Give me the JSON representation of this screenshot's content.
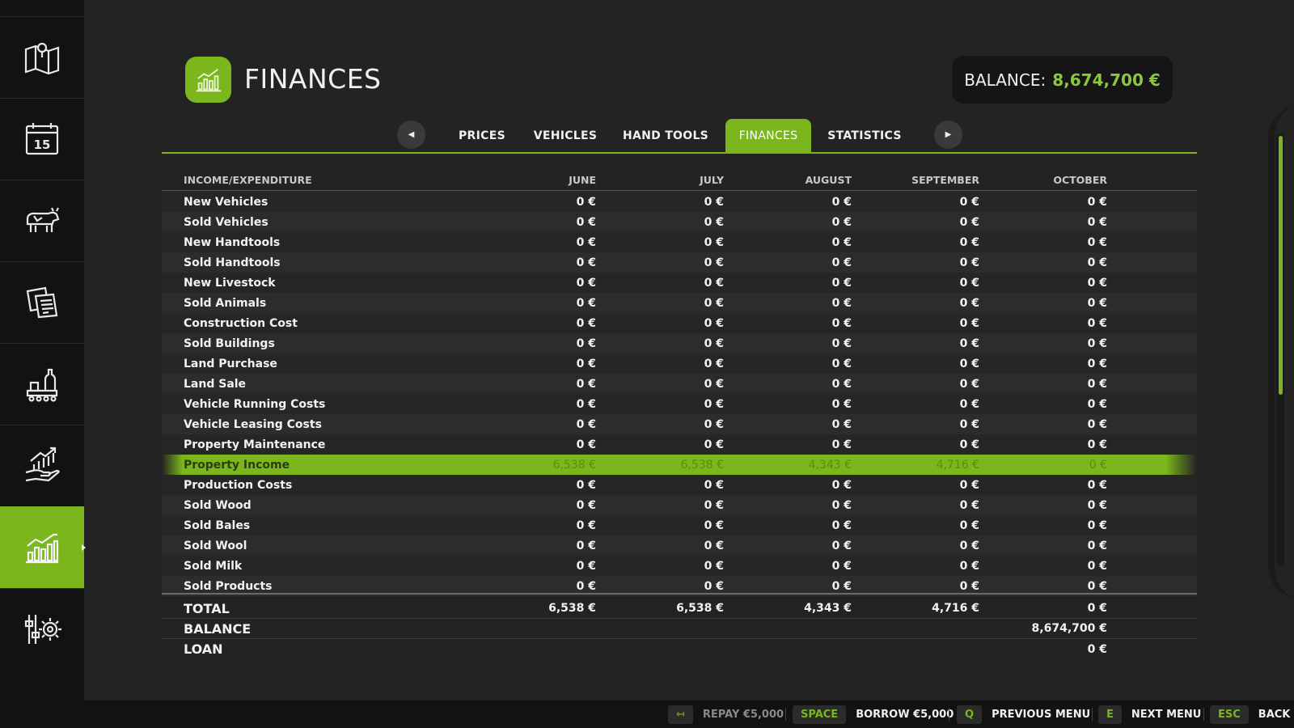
{
  "sidebar": {
    "items": [
      {
        "icon": "map-icon"
      },
      {
        "icon": "calendar-icon",
        "day": "15"
      },
      {
        "icon": "animals-icon"
      },
      {
        "icon": "contracts-icon"
      },
      {
        "icon": "production-icon"
      },
      {
        "icon": "prices-icon"
      },
      {
        "icon": "finances-icon",
        "active": true
      },
      {
        "icon": "settings-icon"
      }
    ]
  },
  "header": {
    "title": "FINANCES",
    "balance_label": "BALANCE:",
    "balance_value": "8,674,700 €"
  },
  "tabs": [
    {
      "label": "PRICES"
    },
    {
      "label": "VEHICLES"
    },
    {
      "label": "HAND TOOLS"
    },
    {
      "label": "FINANCES",
      "active": true
    },
    {
      "label": "STATISTICS"
    }
  ],
  "table": {
    "headers": [
      "INCOME/EXPENDITURE",
      "JUNE",
      "JULY",
      "AUGUST",
      "SEPTEMBER",
      "OCTOBER"
    ],
    "rows": [
      {
        "label": "New Vehicles",
        "values": [
          "0 €",
          "0 €",
          "0 €",
          "0 €",
          "0 €"
        ]
      },
      {
        "label": "Sold Vehicles",
        "values": [
          "0 €",
          "0 €",
          "0 €",
          "0 €",
          "0 €"
        ]
      },
      {
        "label": "New Handtools",
        "values": [
          "0 €",
          "0 €",
          "0 €",
          "0 €",
          "0 €"
        ]
      },
      {
        "label": "Sold Handtools",
        "values": [
          "0 €",
          "0 €",
          "0 €",
          "0 €",
          "0 €"
        ]
      },
      {
        "label": "New Livestock",
        "values": [
          "0 €",
          "0 €",
          "0 €",
          "0 €",
          "0 €"
        ]
      },
      {
        "label": "Sold Animals",
        "values": [
          "0 €",
          "0 €",
          "0 €",
          "0 €",
          "0 €"
        ]
      },
      {
        "label": "Construction Cost",
        "values": [
          "0 €",
          "0 €",
          "0 €",
          "0 €",
          "0 €"
        ]
      },
      {
        "label": "Sold Buildings",
        "values": [
          "0 €",
          "0 €",
          "0 €",
          "0 €",
          "0 €"
        ]
      },
      {
        "label": "Land Purchase",
        "values": [
          "0 €",
          "0 €",
          "0 €",
          "0 €",
          "0 €"
        ]
      },
      {
        "label": "Land Sale",
        "values": [
          "0 €",
          "0 €",
          "0 €",
          "0 €",
          "0 €"
        ]
      },
      {
        "label": "Vehicle Running Costs",
        "values": [
          "0 €",
          "0 €",
          "0 €",
          "0 €",
          "0 €"
        ]
      },
      {
        "label": "Vehicle Leasing Costs",
        "values": [
          "0 €",
          "0 €",
          "0 €",
          "0 €",
          "0 €"
        ]
      },
      {
        "label": "Property Maintenance",
        "values": [
          "0 €",
          "0 €",
          "0 €",
          "0 €",
          "0 €"
        ]
      },
      {
        "label": "Property Income",
        "values": [
          "6,538 €",
          "6,538 €",
          "4,343 €",
          "4,716 €",
          "0 €"
        ],
        "highlighted": true
      },
      {
        "label": "Production Costs",
        "values": [
          "0 €",
          "0 €",
          "0 €",
          "0 €",
          "0 €"
        ]
      },
      {
        "label": "Sold Wood",
        "values": [
          "0 €",
          "0 €",
          "0 €",
          "0 €",
          "0 €"
        ]
      },
      {
        "label": "Sold Bales",
        "values": [
          "0 €",
          "0 €",
          "0 €",
          "0 €",
          "0 €"
        ]
      },
      {
        "label": "Sold Wool",
        "values": [
          "0 €",
          "0 €",
          "0 €",
          "0 €",
          "0 €"
        ]
      },
      {
        "label": "Sold Milk",
        "values": [
          "0 €",
          "0 €",
          "0 €",
          "0 €",
          "0 €"
        ]
      },
      {
        "label": "Sold Products",
        "values": [
          "0 €",
          "0 €",
          "0 €",
          "0 €",
          "0 €"
        ]
      }
    ],
    "total": {
      "label": "TOTAL",
      "values": [
        "6,538 €",
        "6,538 €",
        "4,343 €",
        "4,716 €",
        "0 €"
      ]
    },
    "balance": {
      "label": "BALANCE",
      "value": "8,674,700 €"
    },
    "loan": {
      "label": "LOAN",
      "value": "0 €"
    }
  },
  "footer": {
    "repay": {
      "key": "↤",
      "label": "REPAY €5,000"
    },
    "borrow": {
      "key": "SPACE",
      "label": "BORROW €5,000"
    },
    "previous": {
      "key": "Q",
      "label": "PREVIOUS MENU"
    },
    "next": {
      "key": "E",
      "label": "NEXT MENU"
    },
    "back": {
      "key": "ESC",
      "label": "BACK"
    }
  },
  "colors": {
    "accent": "#7bb61c",
    "balance_value": "#8cc63f",
    "background": "#232323",
    "sidebar": "#121212"
  }
}
